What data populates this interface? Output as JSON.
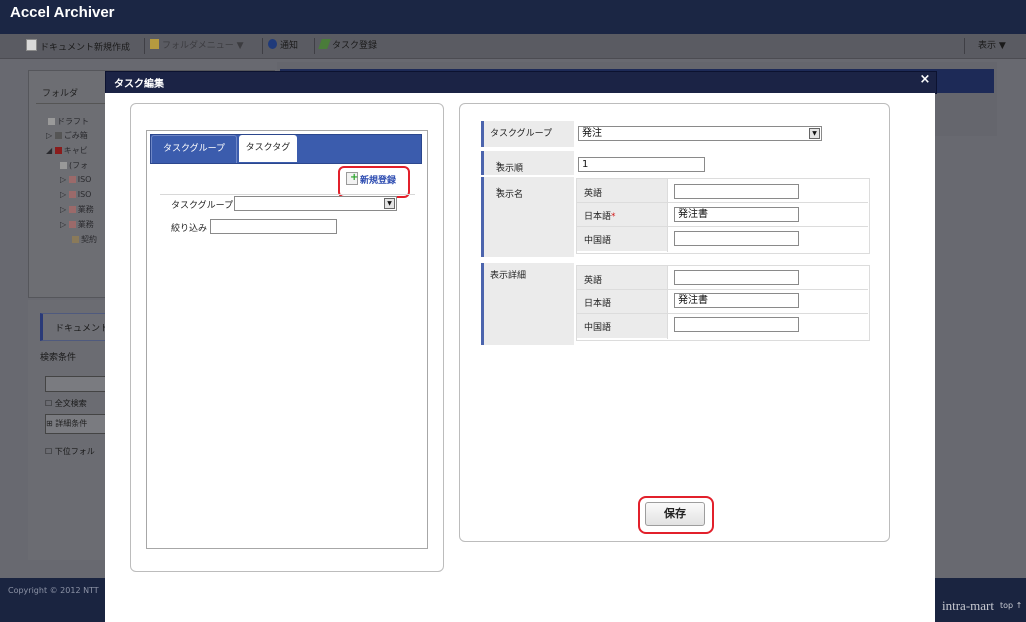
{
  "app": {
    "title": "Accel Archiver",
    "toolbar": {
      "new_document": "ドキュメント新規作成",
      "folder_menu": "フォルダメニュー ▼",
      "notice": "通知",
      "task_register": "タスク登録",
      "display": "表示 ▼"
    },
    "background": {
      "folder_panel_title": "フォルダ",
      "tree": [
        "ドラフト",
        "ごみ箱",
        "キャビ",
        "(フォ",
        "ISO",
        "ISO",
        "業務",
        "業務",
        "契約"
      ],
      "document_tab": "ドキュメント",
      "search_conditions": "検索条件",
      "fulltext_search": "全文検索",
      "detail_conditions": "詳細条件",
      "subfolder": "下位フォル"
    },
    "footer": {
      "copyright": "Copyright © 2012 NTT",
      "brand": "intra-mart",
      "top": "top ↑"
    }
  },
  "modal": {
    "title": "タスク編集",
    "close": "×",
    "tabs": [
      "タスクグループ",
      "タスクタグ"
    ],
    "new_register": "新規登録",
    "filter": {
      "group_label": "タスクグループ",
      "group_value": "",
      "narrow_label": "絞り込み",
      "narrow_value": ""
    },
    "form": {
      "task_group_label": "タスクグループ",
      "task_group_value": "発注",
      "order_label": "表示順",
      "order_value": "1",
      "display_name_label": "表示名",
      "display_name_rows": [
        {
          "lang": "英語",
          "required": false,
          "value": ""
        },
        {
          "lang": "日本語",
          "required": true,
          "value": "発注書"
        },
        {
          "lang": "中国語",
          "required": false,
          "value": ""
        }
      ],
      "detail_label": "表示詳細",
      "detail_rows": [
        {
          "lang": "英語",
          "value": ""
        },
        {
          "lang": "日本語",
          "value": "発注書"
        },
        {
          "lang": "中国語",
          "value": ""
        }
      ],
      "required_mark": "*"
    },
    "save": "保存"
  }
}
